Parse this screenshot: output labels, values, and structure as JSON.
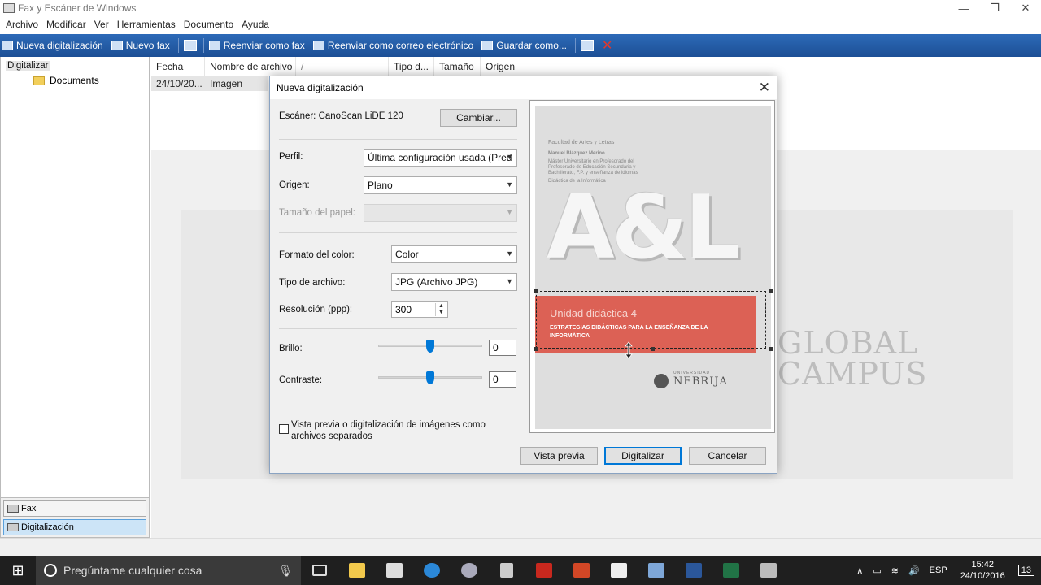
{
  "window": {
    "title": "Fax y Escáner de Windows",
    "minimize": "—",
    "maximize": "❐",
    "close": "✕"
  },
  "menu": [
    "Archivo",
    "Modificar",
    "Ver",
    "Herramientas",
    "Documento",
    "Ayuda"
  ],
  "toolbar": {
    "new_scan": "Nueva digitalización",
    "new_fax": "Nuevo fax",
    "forward_fax": "Reenviar como fax",
    "forward_email": "Reenviar como correo electrónico",
    "save_as": "Guardar como..."
  },
  "tree": {
    "root": "Digitalizar",
    "child": "Documents"
  },
  "left_bottom": {
    "fax": "Fax",
    "scan": "Digitalización"
  },
  "list": {
    "columns": [
      "Fecha de...",
      "Nombre de archivo",
      "/",
      "Tipo d...",
      "Tamaño",
      "Origen"
    ],
    "rows": [
      {
        "date": "24/10/20...",
        "name": "Imagen"
      }
    ]
  },
  "background_preview": {
    "text_line1": "GLOBAL",
    "text_line2": "CAMPUS"
  },
  "taskbar": {
    "search_placeholder": "Pregúntame cualquier cosa",
    "language": "ESP",
    "time": "15:42",
    "date": "24/10/2016",
    "notifications": "13"
  },
  "dialog": {
    "title": "Nueva digitalización",
    "scanner_label": "Escáner: CanoScan LiDE 120",
    "change_button": "Cambiar...",
    "profile_label": "Perfil:",
    "profile_value": "Última configuración usada (Pred",
    "source_label": "Origen:",
    "source_value": "Plano",
    "paper_size_label": "Tamaño del papel:",
    "paper_size_value": "",
    "color_format_label": "Formato del color:",
    "color_format_value": "Color",
    "file_type_label": "Tipo de archivo:",
    "file_type_value": "JPG (Archivo JPG)",
    "resolution_label": "Resolución (ppp):",
    "resolution_value": "300",
    "brightness_label": "Brillo:",
    "brightness_value": "0",
    "brightness_level": 0.5,
    "contrast_label": "Contraste:",
    "contrast_value": "0",
    "contrast_level": 0.5,
    "separate_files_label": "Vista previa o digitalización de imágenes como archivos separados",
    "separate_files_checked": false,
    "preview_button": "Vista previa",
    "scan_button": "Digitalizar",
    "cancel_button": "Cancelar"
  },
  "preview_image": {
    "small_header": "Facultad de Artes y Letras",
    "author": "Manuel Blázquez Merino",
    "author_desc": "Máster Universitario en Profesorado del Profesorado de Educación Secundaria y Bachillerato, F.P. y enseñanza de idiomas",
    "subject": "Didáctica de la Informática",
    "big_letters": "A&L",
    "unit_title": "Unidad didáctica 4",
    "unit_subtitle": "ESTRATEGIAS DIDÁCTICAS PARA LA ENSEÑANZA DE LA INFORMÁTICA",
    "logo_small": "UNIVERSIDAD",
    "logo_name": "NEBRIJA"
  },
  "colors": {
    "toolbar_blue": "#1c4f95",
    "red_band": "#dc6155",
    "accent": "#0078d7"
  }
}
